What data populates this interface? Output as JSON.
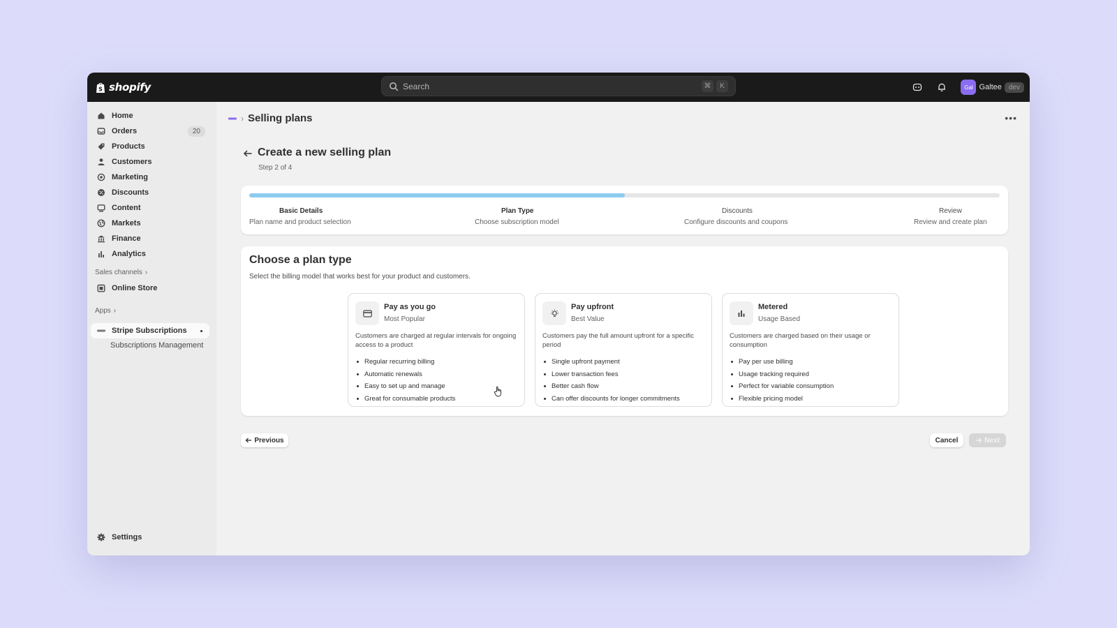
{
  "app": {
    "logo_text": "shopify"
  },
  "search": {
    "placeholder": "Search",
    "kbd_cmd": "⌘",
    "kbd_key": "K"
  },
  "user": {
    "avatar_initials": "Gal",
    "store_name": "Galtee",
    "badge": "dev"
  },
  "sidebar": {
    "items": [
      {
        "label": "Home",
        "icon": "home-icon"
      },
      {
        "label": "Orders",
        "icon": "inbox-icon",
        "badge": "20"
      },
      {
        "label": "Products",
        "icon": "tag-icon"
      },
      {
        "label": "Customers",
        "icon": "person-icon"
      },
      {
        "label": "Marketing",
        "icon": "target-icon"
      },
      {
        "label": "Discounts",
        "icon": "discount-icon"
      },
      {
        "label": "Content",
        "icon": "content-icon"
      },
      {
        "label": "Markets",
        "icon": "globe-icon"
      },
      {
        "label": "Finance",
        "icon": "bank-icon"
      },
      {
        "label": "Analytics",
        "icon": "bar-chart-icon"
      }
    ],
    "sales_channels_label": "Sales channels",
    "online_store_label": "Online Store",
    "apps_label": "Apps",
    "app_item_label": "Stripe Subscriptions",
    "app_subitem_label": "Subscriptions Management",
    "settings_label": "Settings"
  },
  "breadcrumb": {
    "title": "Selling plans"
  },
  "page": {
    "title": "Create a new selling plan",
    "step": "Step 2 of 4"
  },
  "progress": {
    "fraction": 0.5
  },
  "steps": [
    {
      "title": "Basic Details",
      "desc": "Plan name and product selection"
    },
    {
      "title": "Plan Type",
      "desc": "Choose subscription model"
    },
    {
      "title": "Discounts",
      "desc": "Configure discounts and coupons"
    },
    {
      "title": "Review",
      "desc": "Review and create plan"
    }
  ],
  "plan_section": {
    "title": "Choose a plan type",
    "subtitle": "Select the billing model that works best for your product and customers."
  },
  "options": [
    {
      "title": "Pay as you go",
      "tag": "Most Popular",
      "icon": "credit-card-icon",
      "desc": "Customers are charged at regular intervals for ongoing access to a product",
      "features": [
        "Regular recurring billing",
        "Automatic renewals",
        "Easy to set up and manage",
        "Great for consumable products"
      ]
    },
    {
      "title": "Pay upfront",
      "tag": "Best Value",
      "icon": "lightbulb-icon",
      "desc": "Customers pay the full amount upfront for a specific period",
      "features": [
        "Single upfront payment",
        "Lower transaction fees",
        "Better cash flow",
        "Can offer discounts for longer commitments"
      ]
    },
    {
      "title": "Metered",
      "tag": "Usage Based",
      "icon": "chart-icon",
      "desc": "Customers are charged based on their usage or consumption",
      "features": [
        "Pay per use billing",
        "Usage tracking required",
        "Perfect for variable consumption",
        "Flexible pricing model"
      ]
    }
  ],
  "buttons": {
    "previous": "Previous",
    "cancel": "Cancel",
    "next": "Next"
  },
  "colors": {
    "progress_fill": "#8ecbf0",
    "avatar": "#8a6cf0",
    "topbar": "#1a1a1a",
    "background": "#dcdcfa"
  }
}
